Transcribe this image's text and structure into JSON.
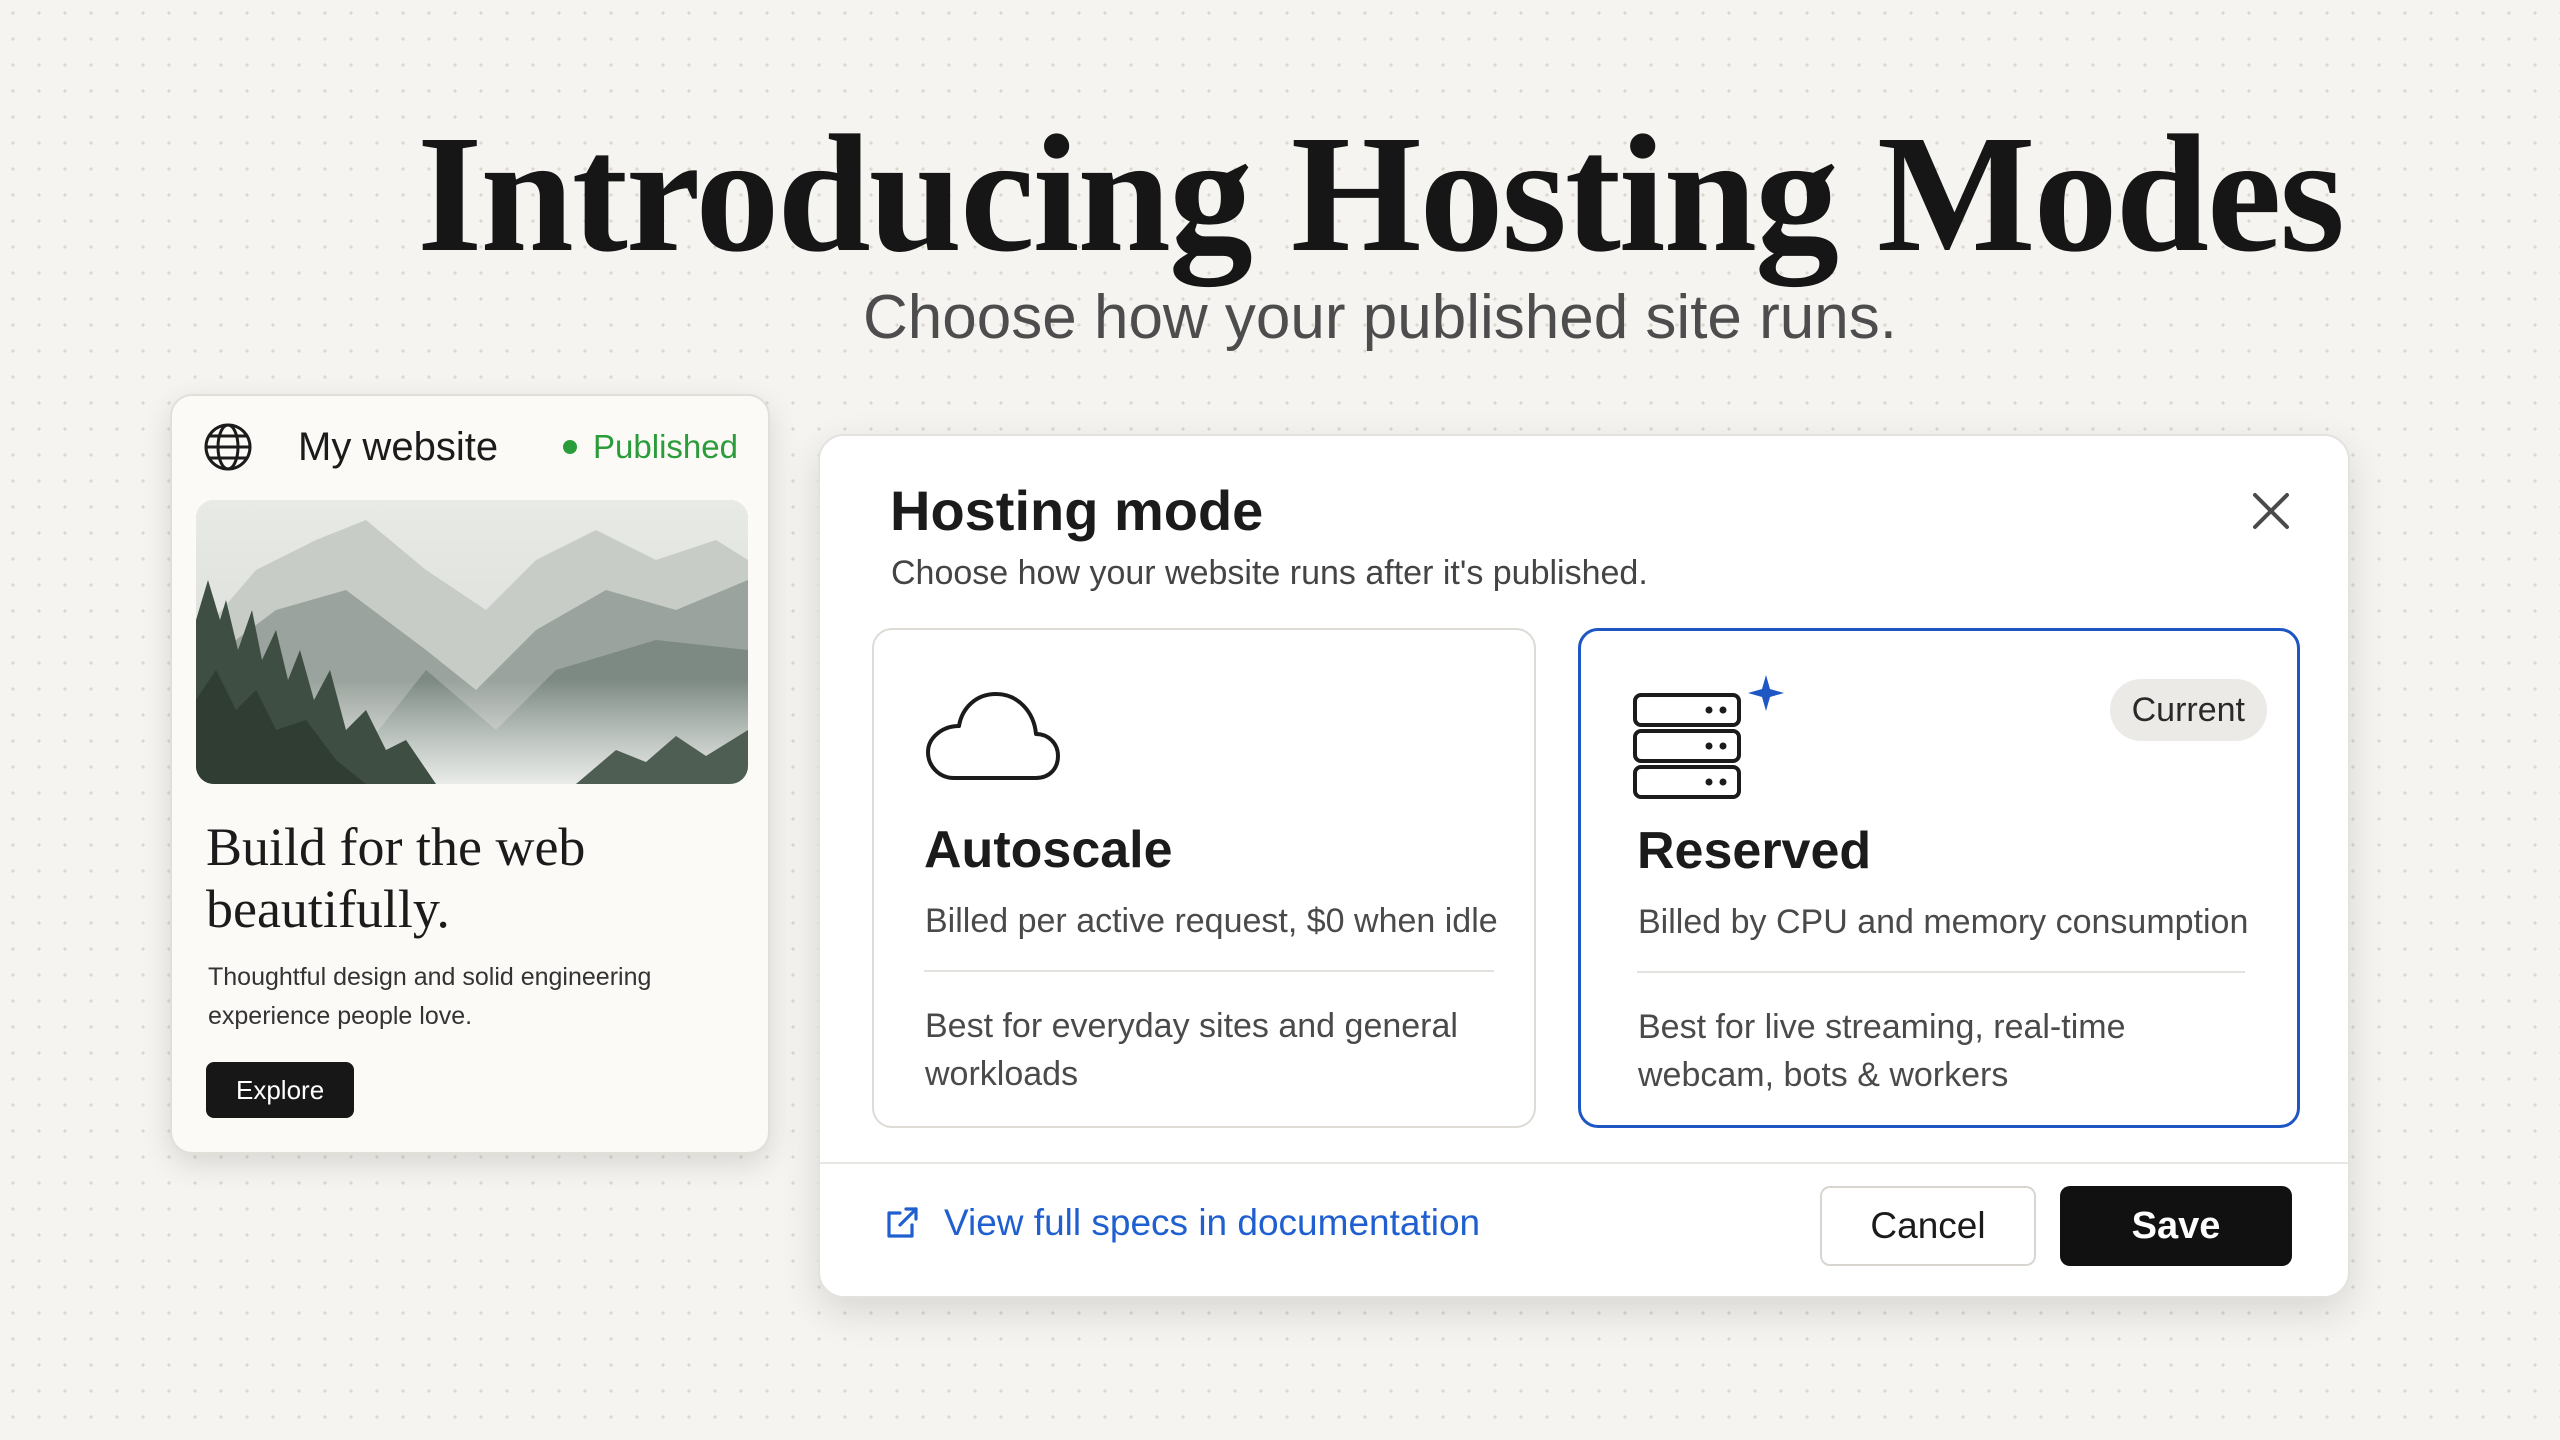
{
  "hero": {
    "title": "Introducing Hosting Modes",
    "subtitle": "Choose how your published site runs."
  },
  "site_card": {
    "icon": "globe-icon",
    "name": "My website",
    "status": "Published",
    "status_color": "#2a9d3a",
    "image": "misty-mountain-forest-landscape",
    "headline": "Build for the web beautifully.",
    "body": "Thoughtful design and solid engineering experience people love.",
    "button_label": "Explore"
  },
  "dialog": {
    "title": "Hosting mode",
    "subtitle": "Choose how your website runs after it's published.",
    "close_icon": "close-icon",
    "selected_mode": "Reserved",
    "accent_color": "#1e56c4",
    "modes": [
      {
        "icon": "cloud-icon",
        "name": "Autoscale",
        "billing": "Billed per active request, $0 when idle",
        "use_case": "Best for everyday sites and general workloads"
      },
      {
        "icon": "server-sparkle-icon",
        "name": "Reserved",
        "badge": "Current",
        "billing": "Billed by CPU and memory consumption",
        "use_case": "Best for live streaming, real-time webcam, bots & workers"
      }
    ],
    "footer": {
      "docs_link": "View full specs in documentation",
      "docs_icon": "external-link-icon",
      "cancel_label": "Cancel",
      "save_label": "Save"
    }
  }
}
